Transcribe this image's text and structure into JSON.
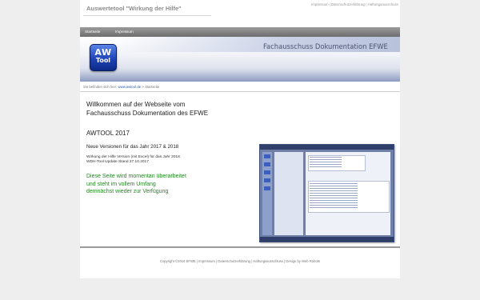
{
  "header": {
    "site_title": "Auswertetool \"Wirkung der Hilfe\"",
    "top_links": [
      "Impressum",
      "Datenschutzerklärung",
      "Haftungsausschuss"
    ]
  },
  "nav": {
    "items": [
      "Startseite",
      "Impressum"
    ]
  },
  "banner": {
    "logo_line1": "AW",
    "logo_line2": "Tool",
    "title": "Fachausschuss Dokumentation EFWE"
  },
  "breadcrumb": {
    "prefix": "Sie befinden sich hier:",
    "link": "www.awtool.de",
    "separator": ">",
    "current": "Startseite"
  },
  "main": {
    "welcome_line1": "Willkommen auf der Webseite vom",
    "welcome_line2": "Fachausschuss Dokumentation des EFWE",
    "product_title": "AWTOOL 2017",
    "versions_heading": "Neue Versionen für das Jahr 2017 & 2018",
    "info_line1": "Wirkung der Hilfe Version (mit Excel)  für das Jahr 2018",
    "info_line2": "WDH-Tool Update Stand 27.10.2017",
    "notice_line1": "Diese Seite wird momentan überarbeitet",
    "notice_line2": "und steht im vollem Umfang",
    "notice_line3": "demnächst wieder zur Verfügung"
  },
  "footer": {
    "text": "Copyright ©2016 EFWE | Impressum | Datenschutzerklärung | Haftungsausschluss | Design by Web Robots"
  },
  "colors": {
    "nav_bar": "#7f7f7f",
    "logo_blue": "#1f44b8",
    "notice_green": "#1d8a1d",
    "link_blue": "#2b5fb3"
  }
}
